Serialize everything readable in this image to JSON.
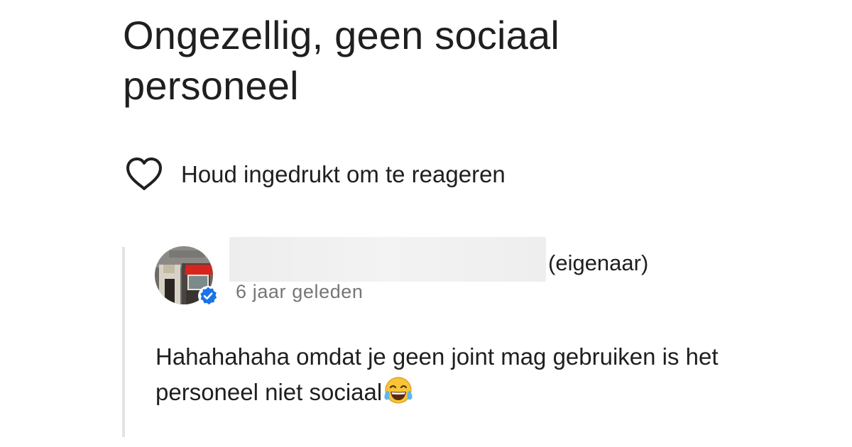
{
  "review": {
    "title": "Ongezellig, geen sociaal personeel"
  },
  "reaction": {
    "label": "Houd ingedrukt om te reageren",
    "icon": "heart-outline-icon"
  },
  "owner_reply": {
    "owner_tag": "(eigenaar)",
    "time": "6 jaar geleden",
    "text": "Hahahahaha omdat je geen joint mag gebruiken is het personeel niet sociaal",
    "emoji": "😂",
    "verified_color": "#1a73e8"
  }
}
